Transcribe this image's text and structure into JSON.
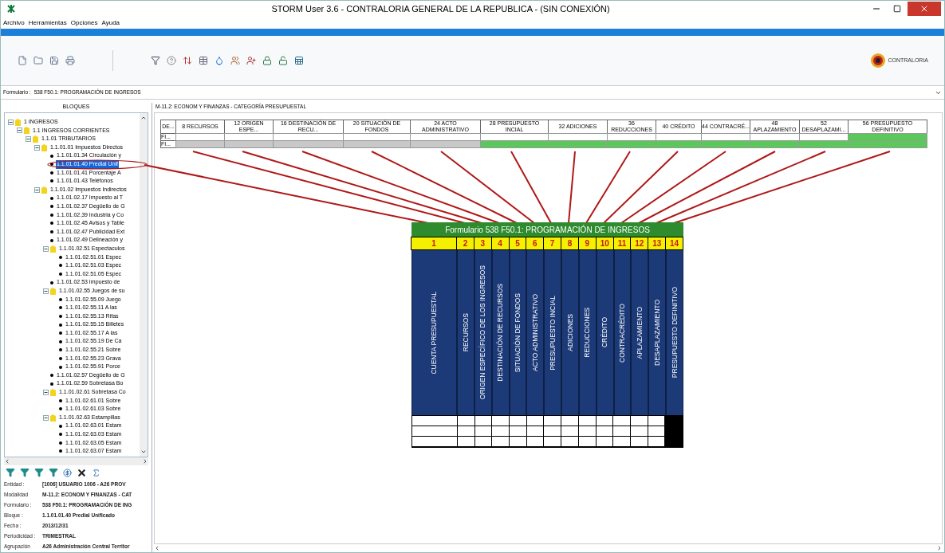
{
  "window": {
    "title": "STORM User 3.6 - CONTRALORIA GENERAL DE LA REPUBLICA - (SIN CONEXIÓN)"
  },
  "menu": [
    "Archivo",
    "Herramientas",
    "Opciones",
    "Ayuda"
  ],
  "logo": {
    "text": "CONTRALORIA"
  },
  "form_bar": {
    "label": "Formulario :",
    "value": "538 F50.1: PROGRAMACIÓN DE INGRESOS"
  },
  "blocks_panel": {
    "title": "BLOQUES",
    "tree": [
      {
        "label": "1 INGRESOS",
        "selected": false,
        "expanded": true,
        "children": [
          {
            "label": "1.1 INGRESOS CORRIENTES",
            "selected": false,
            "expanded": true,
            "children": [
              {
                "label": "1.1.01 TRIBUTARIOS",
                "selected": false,
                "expanded": true,
                "children": [
                  {
                    "label": "1.1.01.01 Impuestos Directos",
                    "selected": false,
                    "expanded": true,
                    "children": [
                      {
                        "label": "1.1.01.01.34 Circulación y",
                        "selected": false
                      },
                      {
                        "label": "1.1.01.01.40 Predial Unif",
                        "selected": true
                      },
                      {
                        "label": "1.1.01.01.41 Porcentaje A",
                        "selected": false
                      },
                      {
                        "label": "1.1.01.01.43 Teléfonos",
                        "selected": false
                      }
                    ]
                  },
                  {
                    "label": "1.1.01.02 Impuestos Indirectos",
                    "selected": false,
                    "expanded": true,
                    "children": [
                      {
                        "label": "1.1.01.02.17 Impuesto al T",
                        "selected": false
                      },
                      {
                        "label": "1.1.01.02.37 Degüello de G",
                        "selected": false
                      },
                      {
                        "label": "1.1.01.02.39 Industria y Co",
                        "selected": false
                      },
                      {
                        "label": "1.1.01.02.45 Avisos y Table",
                        "selected": false
                      },
                      {
                        "label": "1.1.01.02.47 Publicidad Ext",
                        "selected": false
                      },
                      {
                        "label": "1.1.01.02.49 Delineación y",
                        "selected": false
                      },
                      {
                        "label": "1.1.01.02.51 Espectaculos",
                        "selected": false,
                        "expanded": true,
                        "children": [
                          {
                            "label": "1.1.01.02.51.01 Espec",
                            "selected": false
                          },
                          {
                            "label": "1.1.01.02.51.03 Espec",
                            "selected": false
                          },
                          {
                            "label": "1.1.01.02.51.05 Espec",
                            "selected": false
                          }
                        ]
                      },
                      {
                        "label": "1.1.01.02.53 Impuesto de",
                        "selected": false
                      },
                      {
                        "label": "1.1.01.02.55 Juegos de su",
                        "selected": false,
                        "expanded": true,
                        "children": [
                          {
                            "label": "1.1.01.02.55.09 Juego",
                            "selected": false
                          },
                          {
                            "label": "1.1.01.02.55.11 A las",
                            "selected": false
                          },
                          {
                            "label": "1.1.01.02.55.13 Rifas",
                            "selected": false
                          },
                          {
                            "label": "1.1.01.02.55.15 Billetes",
                            "selected": false
                          },
                          {
                            "label": "1.1.01.02.55.17 A las",
                            "selected": false
                          },
                          {
                            "label": "1.1.01.02.55.19 De Ca",
                            "selected": false
                          },
                          {
                            "label": "1.1.01.02.55.21 Sobre",
                            "selected": false
                          },
                          {
                            "label": "1.1.01.02.55.23 Grava",
                            "selected": false
                          },
                          {
                            "label": "1.1.01.02.55.91 Porce",
                            "selected": false
                          }
                        ]
                      },
                      {
                        "label": "1.1.01.02.57 Degüello de G",
                        "selected": false
                      },
                      {
                        "label": "1.1.01.02.59 Sobretasa Bo",
                        "selected": false
                      },
                      {
                        "label": "1.1.01.02.61 Sobretasa Co",
                        "selected": false,
                        "expanded": true,
                        "children": [
                          {
                            "label": "1.1.01.02.61.01 Sobre",
                            "selected": false
                          },
                          {
                            "label": "1.1.01.02.61.03 Sobre",
                            "selected": false
                          }
                        ]
                      },
                      {
                        "label": "1.1.01.02.63 Estampillas",
                        "selected": false,
                        "expanded": true,
                        "children": [
                          {
                            "label": "1.1.01.02.63.01 Estam",
                            "selected": false
                          },
                          {
                            "label": "1.1.01.02.63.03 Estam",
                            "selected": false
                          },
                          {
                            "label": "1.1.01.02.63.05 Estam",
                            "selected": false
                          },
                          {
                            "label": "1.1.01.02.63.07 Estam",
                            "selected": false
                          }
                        ]
                      }
                    ]
                  }
                ]
              }
            ]
          }
        ]
      }
    ]
  },
  "info": [
    {
      "label": "Entidad :",
      "value": "[1006] USUARIO 1006 - A26 PROV"
    },
    {
      "label": "Modalidad",
      "value": "M-11.2: ECONOM Y FINANZAS - CAT"
    },
    {
      "label": "Formulario :",
      "value": "538 F50.1: PROGRAMACIÓN DE ING"
    },
    {
      "label": "Bloque :",
      "value": "1.1.01.01.40 Predial Unificado"
    },
    {
      "label": "Fecha :",
      "value": "2013/12/31"
    },
    {
      "label": "Periodicidad :",
      "value": "TRIMESTRAL"
    },
    {
      "label": "Agrupación",
      "value": "A26 Administración Central Territor"
    }
  ],
  "tab": {
    "label": "M-11.2: ECONOM Y FINANZAS - CATEGORÍA PRESUPUESTAL"
  },
  "grid": {
    "columns": [
      "DE...",
      "8 RECURSOS",
      "12 ORIGEN ESPE...",
      "16 DESTINACIÓN DE RECU...",
      "20 SITUACIÓN DE FONDOS",
      "24 ACTO ADMINISTRATIVO",
      "28 PRESUPUESTO INCIAL",
      "32 ADICIONES",
      "36 REDUCCIONES",
      "40 CRÉDITO",
      "44 CONTRACRÉ...",
      "48 APLAZAMIENTO",
      "52 DESAPLAZAMI...",
      "56 PRESUPUESTO DEFINITIVO"
    ],
    "rows": [
      {
        "label": "FI...",
        "cells": [
          {
            "kind": "editable"
          },
          {
            "kind": "editable"
          },
          {
            "kind": "editable"
          },
          {
            "kind": "editable"
          },
          {
            "kind": "editable"
          },
          {
            "kind": "editable"
          },
          {
            "kind": "editable"
          },
          {
            "kind": "editable"
          },
          {
            "kind": "editable"
          },
          {
            "kind": "editable"
          },
          {
            "kind": "editable"
          },
          {
            "kind": "editable"
          },
          {
            "kind": "calculated"
          }
        ]
      },
      {
        "label": "FI...",
        "cells": [
          {
            "kind": "locked"
          },
          {
            "kind": "locked"
          },
          {
            "kind": "locked"
          },
          {
            "kind": "locked"
          },
          {
            "kind": "locked"
          },
          {
            "kind": "calculated"
          },
          {
            "kind": "calculated"
          },
          {
            "kind": "calculated"
          },
          {
            "kind": "calculated"
          },
          {
            "kind": "calculated"
          },
          {
            "kind": "calculated"
          },
          {
            "kind": "calculated"
          },
          {
            "kind": "calculated"
          }
        ]
      }
    ]
  },
  "overlay_form": {
    "title": "Formulario 538 F50.1: PROGRAMACIÓN DE INGRESOS",
    "columns": [
      {
        "number": "1",
        "heading": "CUENTA PRESUPUESTAL",
        "shaded": false
      },
      {
        "number": "2",
        "heading": "RECURSOS",
        "shaded": false
      },
      {
        "number": "3",
        "heading": "ORIGEN ESPECÍFICO DE LOS INGRESOS",
        "shaded": false
      },
      {
        "number": "4",
        "heading": "DESTINACIÓN DE RECURSOS",
        "shaded": false
      },
      {
        "number": "5",
        "heading": "SITUACIÓN DE FONDOS",
        "shaded": false
      },
      {
        "number": "6",
        "heading": "ACTO ADMINISTRATIVO",
        "shaded": false
      },
      {
        "number": "7",
        "heading": "PRESUPUESTO INCIAL",
        "shaded": false
      },
      {
        "number": "8",
        "heading": "ADICIONES",
        "shaded": false
      },
      {
        "number": "9",
        "heading": "REDUCCIONES",
        "shaded": false
      },
      {
        "number": "10",
        "heading": "CRÉDITO",
        "shaded": false
      },
      {
        "number": "11",
        "heading": "CONTRACRÉDITO",
        "shaded": false
      },
      {
        "number": "12",
        "heading": "APLAZAMIENTO",
        "shaded": false
      },
      {
        "number": "13",
        "heading": "DESAPLAZAMIENTO",
        "shaded": false
      },
      {
        "number": "14",
        "heading": "PRESUPUESTO DEFINITIVO",
        "shaded": true
      }
    ]
  }
}
